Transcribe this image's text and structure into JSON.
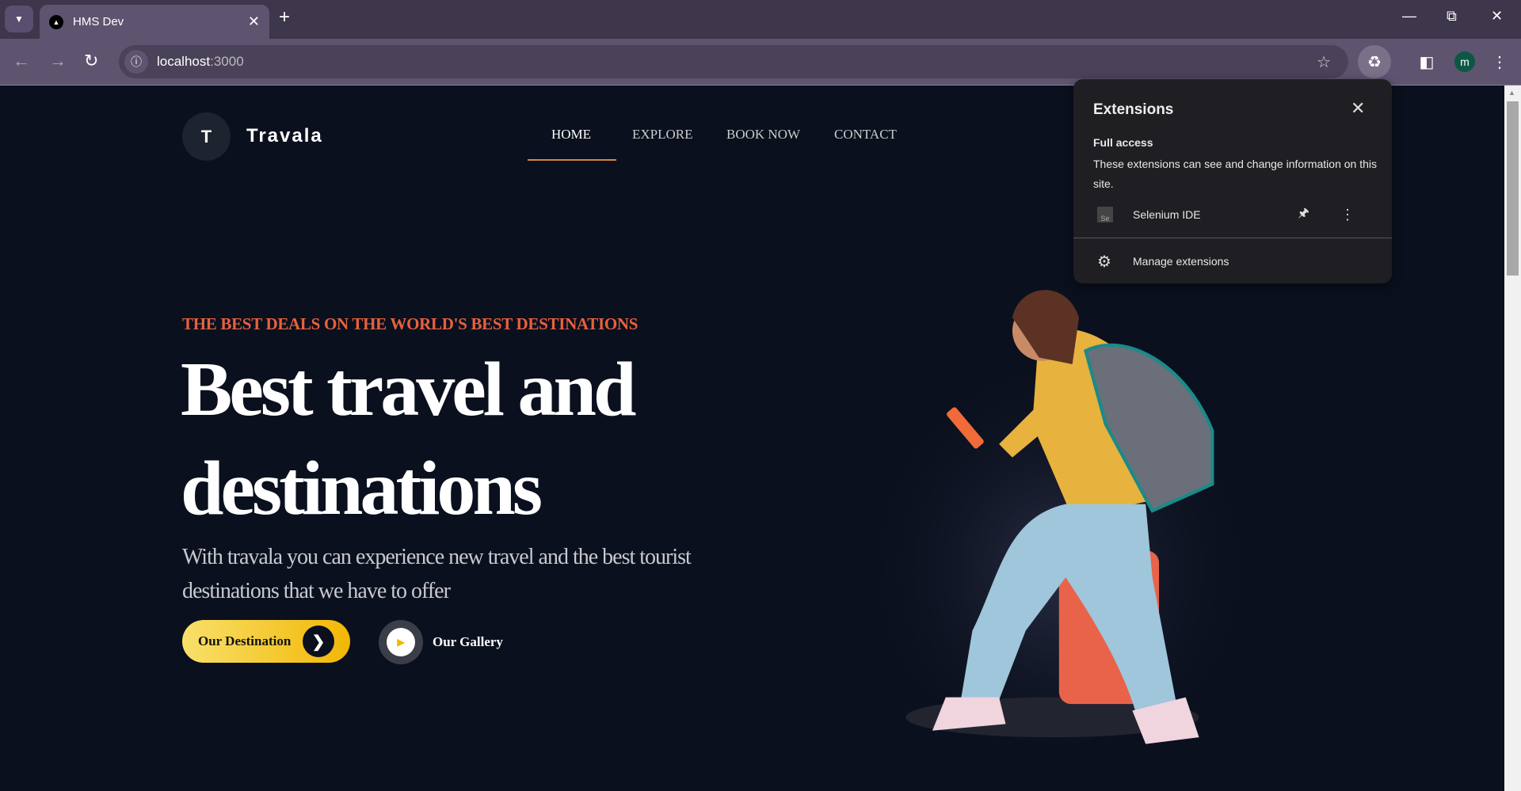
{
  "browser": {
    "tab_title": "HMS Dev",
    "url_host": "localhost",
    "url_port": ":3000",
    "profile_initial": "m"
  },
  "extensions_popup": {
    "title": "Extensions",
    "section_title": "Full access",
    "section_desc": "These extensions can see and change information on this site.",
    "extension_name": "Selenium IDE",
    "extension_icon_text": "Se",
    "manage_label": "Manage extensions"
  },
  "site": {
    "logo_letter": "T",
    "brand": "Travala",
    "nav": [
      {
        "label": "HOME",
        "active": true
      },
      {
        "label": "EXPLORE"
      },
      {
        "label": "BOOK NOW"
      },
      {
        "label": "CONTACT"
      }
    ],
    "hero": {
      "tagline": "THE BEST DEALS ON THE WORLD'S BEST DESTINATIONS",
      "headline": "Best travel and destinations",
      "paragraph": "With travala you can experience new travel and the best tourist destinations that we have to offer",
      "primary_button": "Our Destination",
      "secondary_button": "Our Gallery"
    }
  },
  "colors": {
    "accent": "#e8613c",
    "button": "#f2b705",
    "background": "#0b101e"
  }
}
